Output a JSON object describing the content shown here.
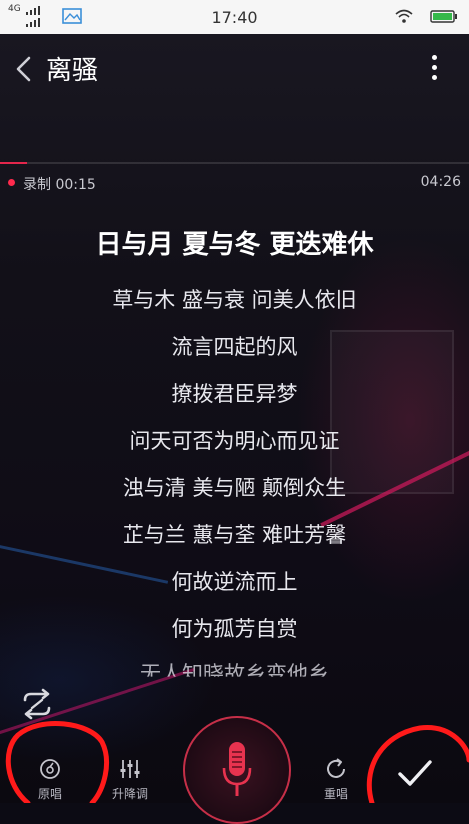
{
  "status_bar": {
    "network_label": "4G",
    "time": "17:40"
  },
  "header": {
    "title": "离骚"
  },
  "recording": {
    "label": "录制 00:15",
    "duration": "04:26",
    "progress": 0.057
  },
  "lyrics": [
    "日与月 夏与冬 更迭难休",
    "草与木 盛与衰 问美人依旧",
    "流言四起的风",
    "撩拨君臣异梦",
    "问天可否为明心而见证",
    "浊与清 美与陋 颠倒众生",
    "芷与兰 蕙与荃 难吐芳馨",
    "何故逆流而上",
    "何为孤芳自赏",
    "无人知晓故乡变他乡"
  ],
  "controls": {
    "original_label": "原唱",
    "pitch_label": "升降调",
    "retake_label": "重唱"
  },
  "colors": {
    "accent": "#e3264c",
    "annotation": "#ff0000"
  },
  "icons": [
    "back-icon",
    "more-icon",
    "loop-icon",
    "original-vocal-icon",
    "pitch-icon",
    "mic-icon",
    "retake-icon",
    "check-icon"
  ]
}
